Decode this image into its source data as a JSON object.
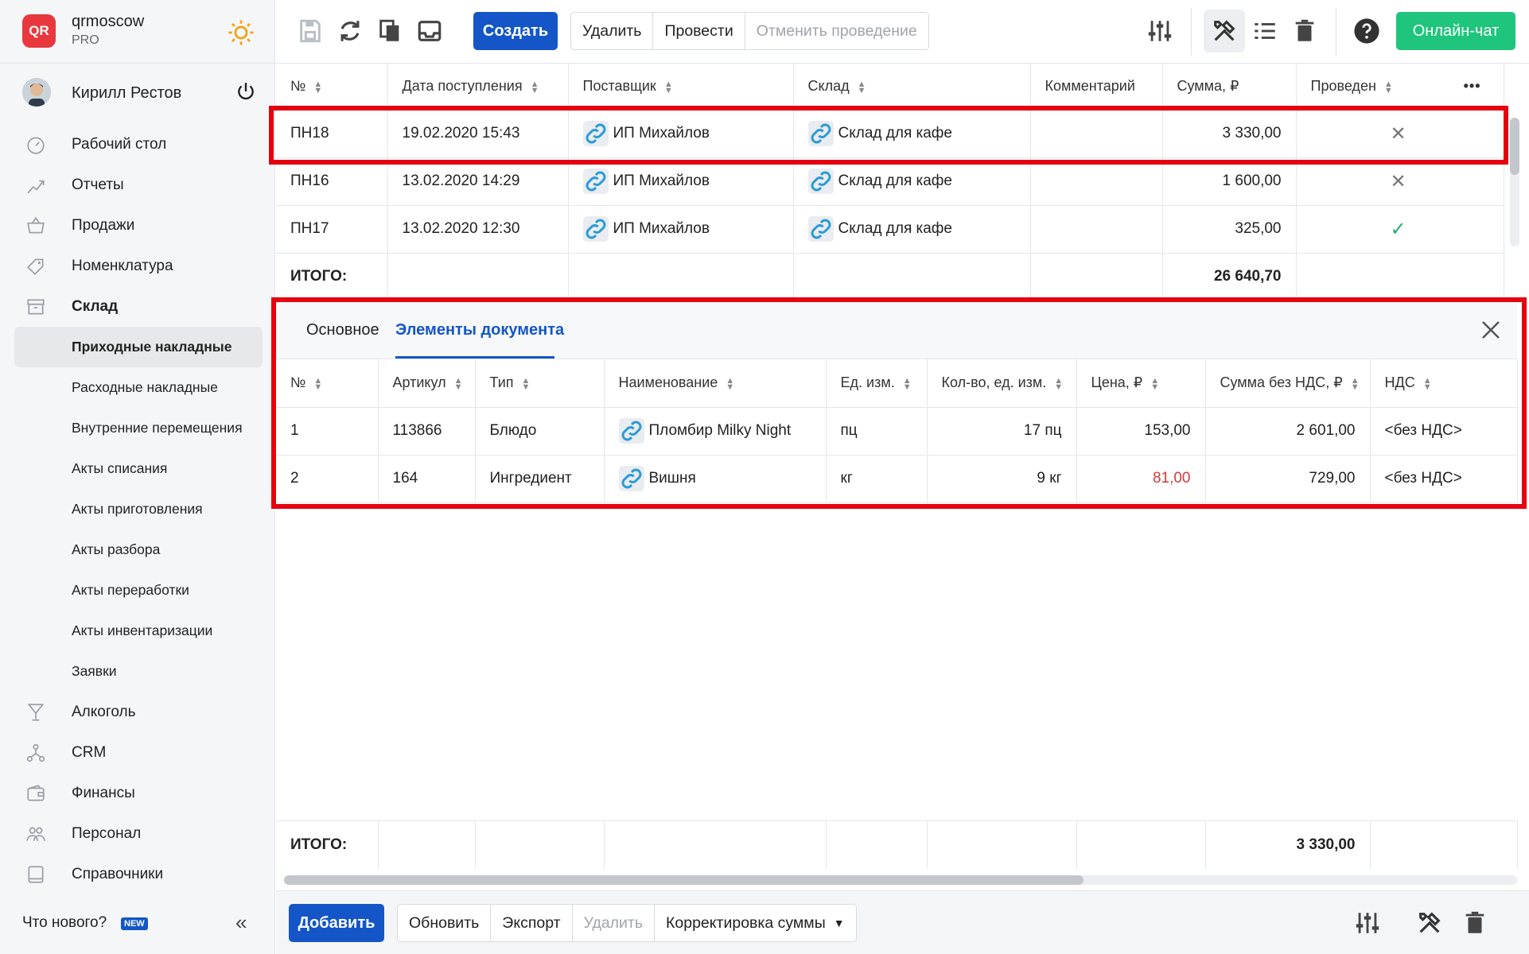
{
  "brand": {
    "name": "qrmoscow",
    "tier": "PRO",
    "logo_text": "QR"
  },
  "user": {
    "name": "Кирилл Рестов"
  },
  "nav": [
    {
      "label": "Рабочий стол",
      "icon": "dashboard-icon"
    },
    {
      "label": "Отчеты",
      "icon": "chart-icon"
    },
    {
      "label": "Продажи",
      "icon": "basket-icon"
    },
    {
      "label": "Номенклатура",
      "icon": "tag-icon"
    },
    {
      "label": "Склад",
      "icon": "box-icon"
    },
    {
      "label": "Приходные накладные",
      "sub": true,
      "active": true
    },
    {
      "label": "Расходные накладные",
      "sub": true
    },
    {
      "label": "Внутренние перемещения",
      "sub": true
    },
    {
      "label": "Акты списания",
      "sub": true
    },
    {
      "label": "Акты приготовления",
      "sub": true
    },
    {
      "label": "Акты разбора",
      "sub": true
    },
    {
      "label": "Акты переработки",
      "sub": true
    },
    {
      "label": "Акты инвентаризации",
      "sub": true
    },
    {
      "label": "Заявки",
      "sub": true
    },
    {
      "label": "Алкоголь",
      "icon": "glass-icon"
    },
    {
      "label": "CRM",
      "icon": "network-icon"
    },
    {
      "label": "Финансы",
      "icon": "wallet-icon"
    },
    {
      "label": "Персонал",
      "icon": "people-icon"
    },
    {
      "label": "Справочники",
      "icon": "book-icon"
    }
  ],
  "sidebar_footer": {
    "whats_new": "Что нового?",
    "badge": "NEW",
    "collapse": "«"
  },
  "toolbar": {
    "create": "Создать",
    "delete": "Удалить",
    "post": "Провести",
    "unpost": "Отменить проведение",
    "chat": "Онлайн-чат"
  },
  "top_table": {
    "headers": [
      "№",
      "Дата поступления",
      "Поставщик",
      "Склад",
      "Комментарий",
      "Сумма, ₽",
      "Проведен"
    ],
    "rows": [
      {
        "no": "ПН18",
        "date": "19.02.2020 15:43",
        "supplier": "ИП Михайлов",
        "warehouse": "Склад для кафе",
        "comment": "",
        "sum": "3 330,00",
        "posted": "✕"
      },
      {
        "no": "ПН16",
        "date": "13.02.2020 14:29",
        "supplier": "ИП Михайлов",
        "warehouse": "Склад для кафе",
        "comment": "",
        "sum": "1 600,00",
        "posted": "✕"
      },
      {
        "no": "ПН17",
        "date": "13.02.2020 12:30",
        "supplier": "ИП Михайлов",
        "warehouse": "Склад для кафе",
        "comment": "",
        "sum": "325,00",
        "posted": "✓"
      }
    ],
    "total_label": "ИТОГО:",
    "total_sum": "26 640,70",
    "more": "•••"
  },
  "detail": {
    "tabs": [
      "Основное",
      "Элементы документа"
    ],
    "headers": [
      "№",
      "Артикул",
      "Тип",
      "Наименование",
      "Ед. изм.",
      "Кол-во, ед. изм.",
      "Цена, ₽",
      "Сумма без НДС, ₽",
      "НДС"
    ],
    "rows": [
      {
        "no": "1",
        "sku": "113866",
        "type": "Блюдо",
        "name": "Пломбир Milky Night",
        "unit": "пц",
        "qty": "17 пц",
        "price": "153,00",
        "sum": "2 601,00",
        "vat": "<без НДС>"
      },
      {
        "no": "2",
        "sku": "164",
        "type": "Ингредиент",
        "name": "Вишня",
        "unit": "кг",
        "qty": "9 кг",
        "price": "81,00",
        "sum": "729,00",
        "vat": "<без НДС>"
      }
    ],
    "total_label": "ИТОГО:",
    "total_sum": "3 330,00"
  },
  "bottombar": {
    "add": "Добавить",
    "refresh": "Обновить",
    "export": "Экспорт",
    "delete": "Удалить",
    "adjust": "Корректировка суммы"
  }
}
